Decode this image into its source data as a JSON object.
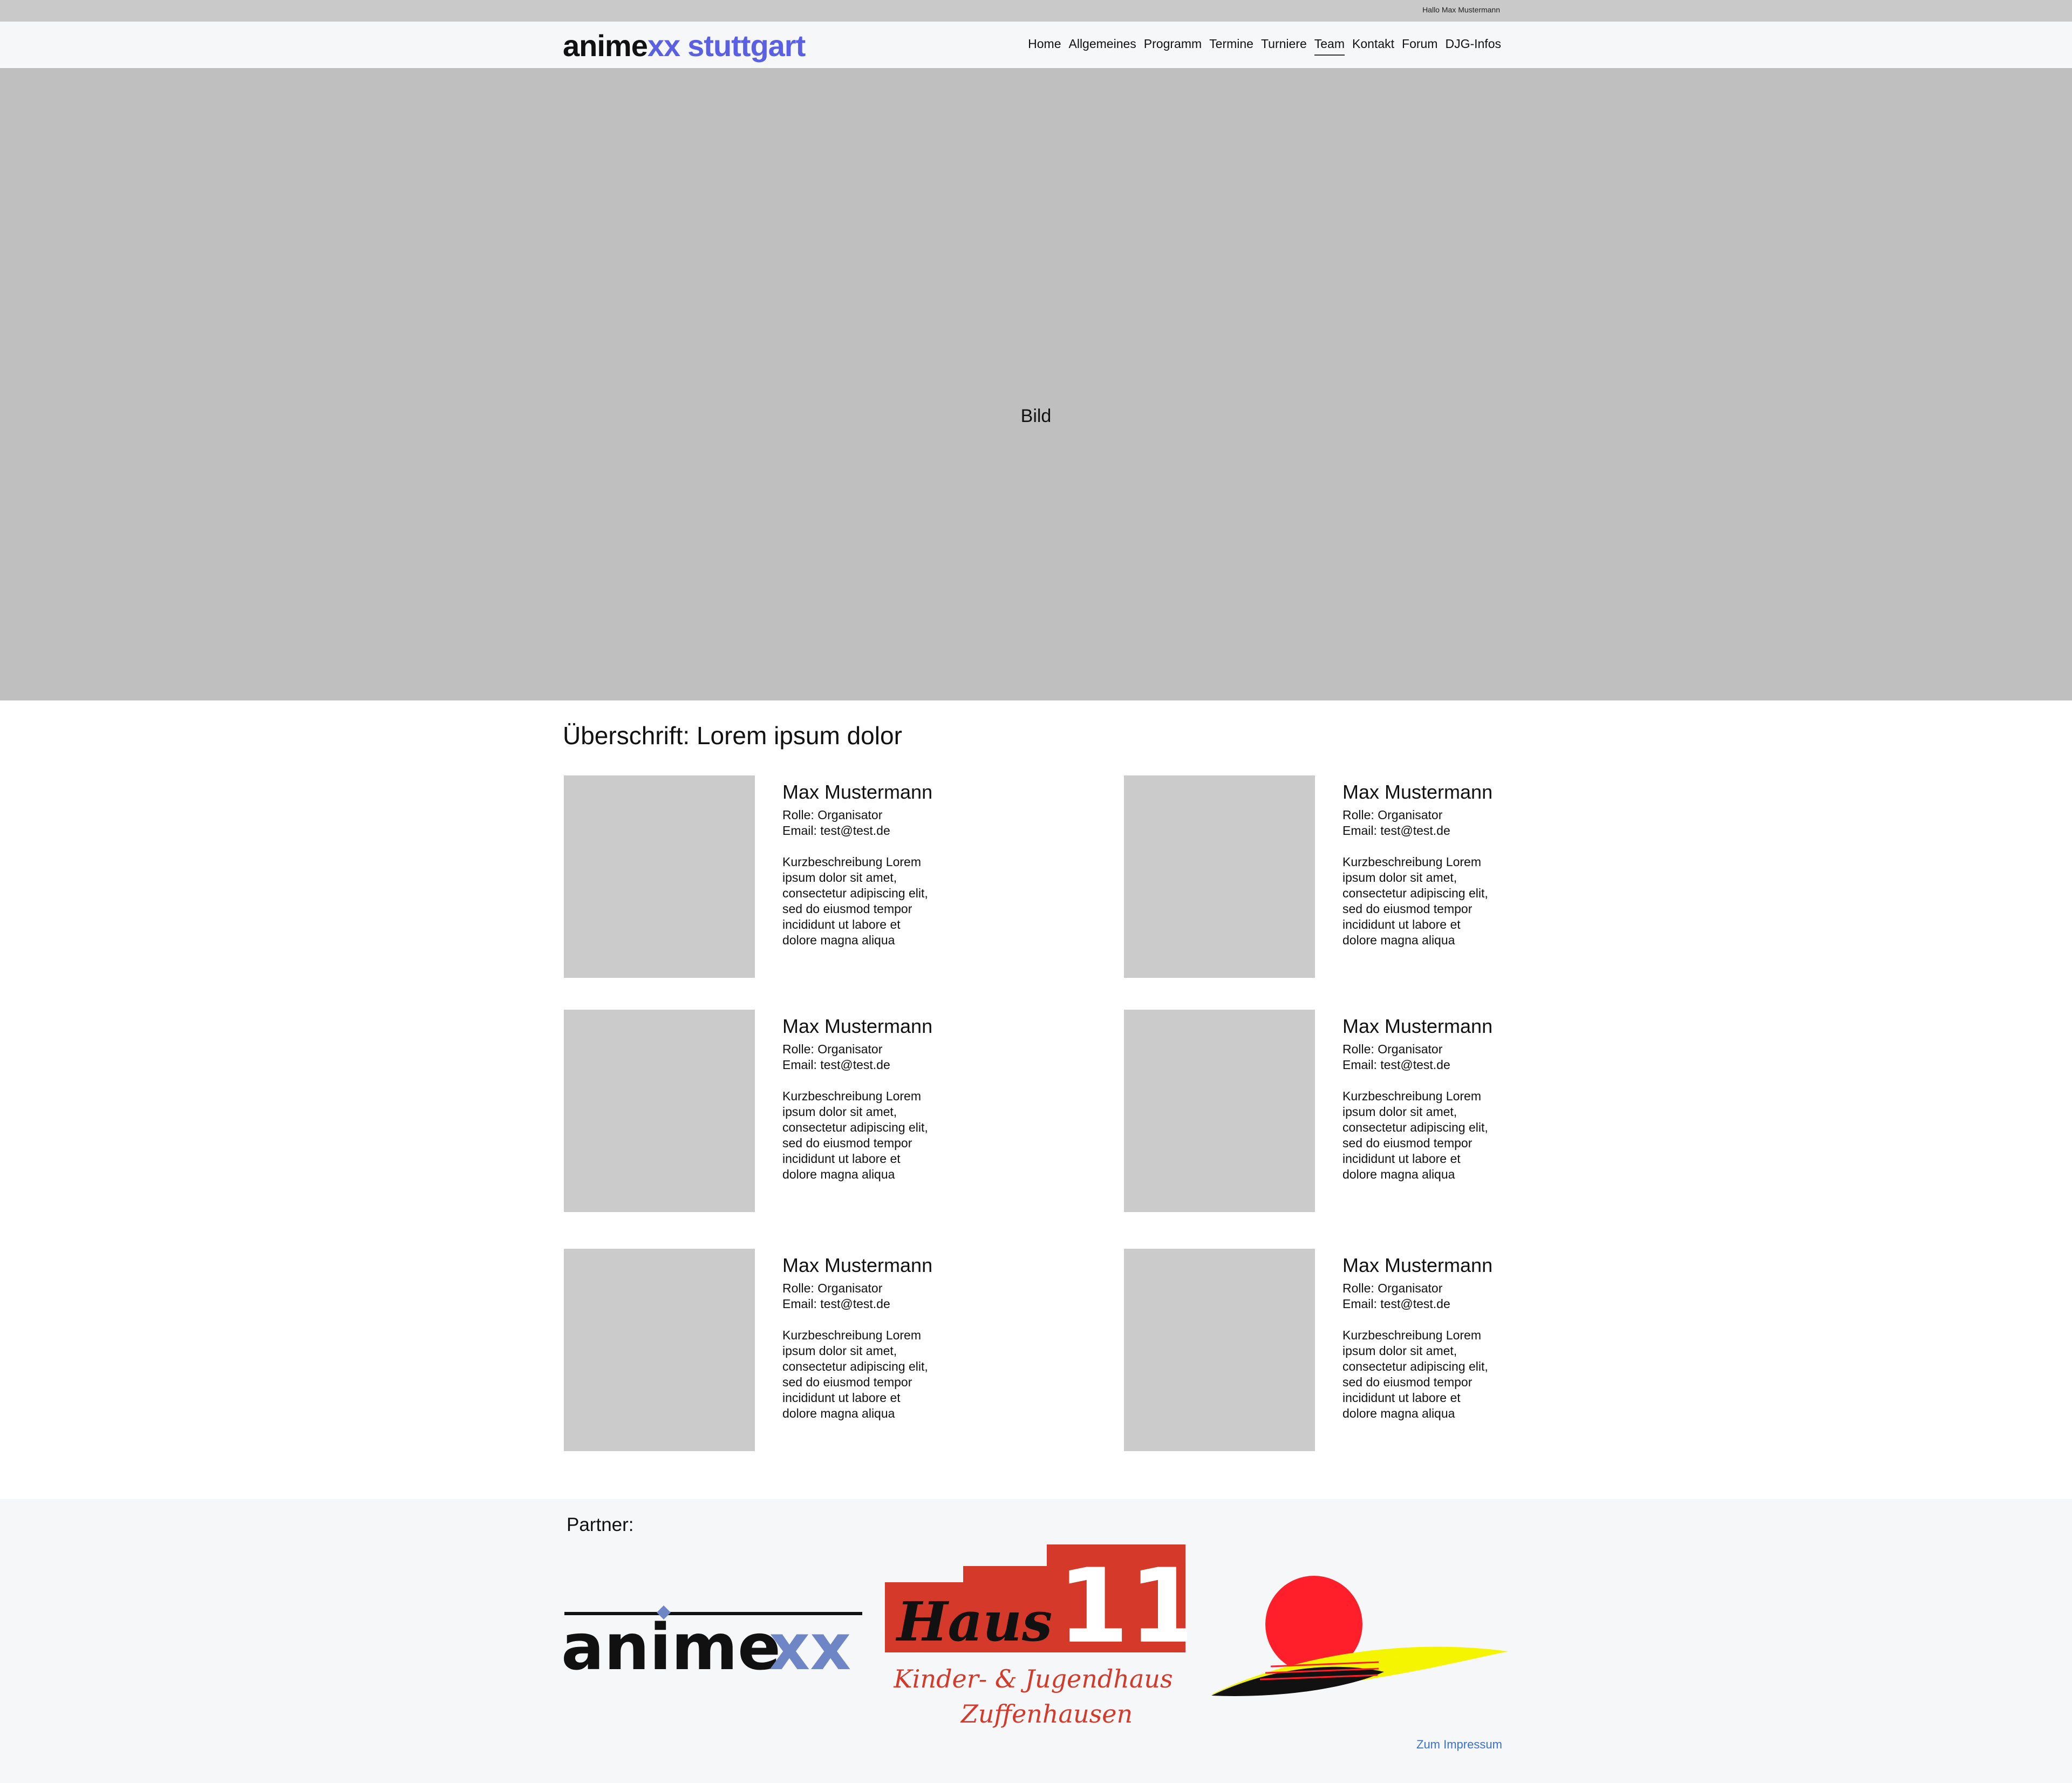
{
  "header": {
    "greeting": "Hallo Max Mustermann",
    "logo": {
      "part1": "anime",
      "part2": "xx",
      "city": "stuttgart"
    },
    "nav": [
      {
        "label": "Home",
        "active": false
      },
      {
        "label": "Allgemeines",
        "active": false
      },
      {
        "label": "Programm",
        "active": false
      },
      {
        "label": "Termine",
        "active": false
      },
      {
        "label": "Turniere",
        "active": false
      },
      {
        "label": "Team",
        "active": true
      },
      {
        "label": "Kontakt",
        "active": false
      },
      {
        "label": "Forum",
        "active": false
      },
      {
        "label": "DJG-Infos",
        "active": false
      }
    ]
  },
  "hero": {
    "label": "Bild"
  },
  "main": {
    "heading": "Überschrift: Lorem ipsum dolor",
    "members": [
      {
        "name": "Max Mustermann",
        "role": "Rolle: Organisator",
        "email": "Email: test@test.de",
        "desc": [
          "Kurzbeschreibung Lorem",
          "ipsum dolor sit amet,",
          "consectetur adipiscing elit,",
          "sed do eiusmod tempor",
          "incididunt ut labore et",
          "dolore magna aliqua"
        ]
      },
      {
        "name": "Max Mustermann",
        "role": "Rolle: Organisator",
        "email": "Email: test@test.de",
        "desc": [
          "Kurzbeschreibung Lorem",
          "ipsum dolor sit amet,",
          "consectetur adipiscing elit,",
          "sed do eiusmod tempor",
          "incididunt ut labore et",
          "dolore magna aliqua"
        ]
      },
      {
        "name": "Max Mustermann",
        "role": "Rolle: Organisator",
        "email": "Email: test@test.de",
        "desc": [
          "Kurzbeschreibung Lorem",
          "ipsum dolor sit amet,",
          "consectetur adipiscing elit,",
          "sed do eiusmod tempor",
          "incididunt ut labore et",
          "dolore magna aliqua"
        ]
      },
      {
        "name": "Max Mustermann",
        "role": "Rolle: Organisator",
        "email": "Email: test@test.de",
        "desc": [
          "Kurzbeschreibung Lorem",
          "ipsum dolor sit amet,",
          "consectetur adipiscing elit,",
          "sed do eiusmod tempor",
          "incididunt ut labore et",
          "dolore magna aliqua"
        ]
      },
      {
        "name": "Max Mustermann",
        "role": "Rolle: Organisator",
        "email": "Email: test@test.de",
        "desc": [
          "Kurzbeschreibung Lorem",
          "ipsum dolor sit amet,",
          "consectetur adipiscing elit,",
          "sed do eiusmod tempor",
          "incididunt ut labore et",
          "dolore magna aliqua"
        ]
      },
      {
        "name": "Max Mustermann",
        "role": "Rolle: Organisator",
        "email": "Email: test@test.de",
        "desc": [
          "Kurzbeschreibung Lorem",
          "ipsum dolor sit amet,",
          "consectetur adipiscing elit,",
          "sed do eiusmod tempor",
          "incididunt ut labore et",
          "dolore magna aliqua"
        ]
      }
    ]
  },
  "footer": {
    "partner_label": "Partner:",
    "partners": {
      "animexx": {
        "part1": "anime",
        "part2": "xx"
      },
      "haus11": {
        "title": "Haus",
        "number": "11",
        "line1": "Kinder- & Jugendhaus",
        "line2": "Zuffenhausen"
      }
    },
    "impressum": "Zum Impressum"
  },
  "colors": {
    "brand_blue": "#5a5fe3",
    "partner_blue": "#6f86c6",
    "haus_red": "#d4392a",
    "sun_red": "#ff1f2a",
    "sun_yellow": "#f5f500",
    "link_blue": "#3a6fd3",
    "placeholder_gray": "#cbcbcb"
  }
}
